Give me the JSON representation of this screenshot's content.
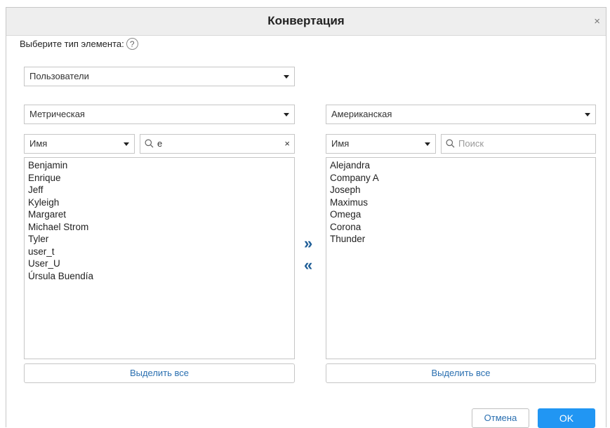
{
  "dialog": {
    "title": "Конвертация",
    "close_glyph": "×",
    "prompt": "Выберите тип элемента:",
    "help_glyph": "?"
  },
  "element_type": {
    "selected": "Пользователи"
  },
  "left": {
    "system": "Метрическая",
    "field": "Имя",
    "search_value": "е",
    "clear_glyph": "×",
    "items": [
      "Benjamin",
      "Enrique",
      "Jeff",
      "Kyleigh",
      "Margaret",
      "Michael Strom",
      "Tyler",
      "user_t",
      "User_U",
      "Úrsula Buendía"
    ],
    "select_all": "Выделить все"
  },
  "right": {
    "system": "Американская",
    "field": "Имя",
    "search_placeholder": "Поиск",
    "items": [
      "Alejandra",
      "Company A",
      "Joseph",
      "Maximus",
      "Omega",
      "Corona",
      "Thunder"
    ],
    "select_all": "Выделить все"
  },
  "transfer": {
    "move_right": "»",
    "move_left": "«"
  },
  "footer": {
    "cancel": "Отмена",
    "ok": "OK"
  },
  "colors": {
    "accent": "#2196f3",
    "link": "#2a6fb0",
    "arrows": "#1f5e97"
  }
}
